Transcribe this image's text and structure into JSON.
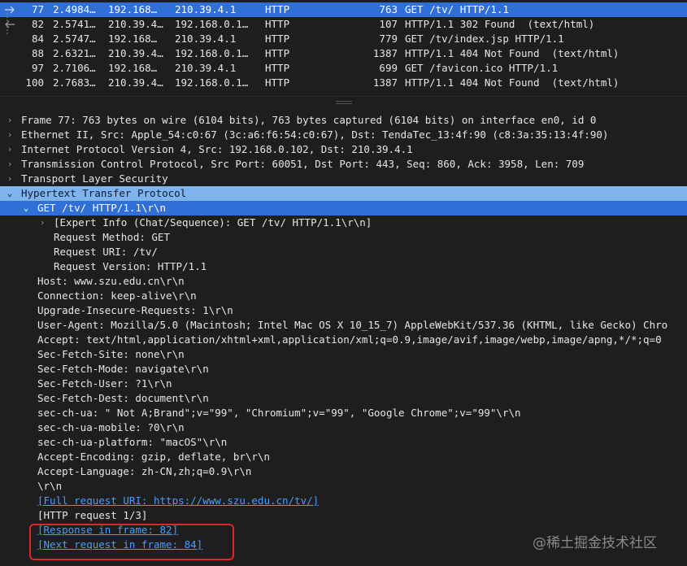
{
  "packets": [
    {
      "no": "77",
      "time": "2.4984…",
      "src": "192.168…",
      "dst": "210.39.4.1",
      "proto": "HTTP",
      "len": "763",
      "info": "GET /tv/ HTTP/1.1",
      "selected": true
    },
    {
      "no": "82",
      "time": "2.5741…",
      "src": "210.39.4…",
      "dst": "192.168.0.1…",
      "proto": "HTTP",
      "len": "107",
      "info": "HTTP/1.1 302 Found  (text/html)",
      "selected": false
    },
    {
      "no": "84",
      "time": "2.5747…",
      "src": "192.168…",
      "dst": "210.39.4.1",
      "proto": "HTTP",
      "len": "779",
      "info": "GET /tv/index.jsp HTTP/1.1",
      "selected": false
    },
    {
      "no": "88",
      "time": "2.6321…",
      "src": "210.39.4…",
      "dst": "192.168.0.1…",
      "proto": "HTTP",
      "len": "1387",
      "info": "HTTP/1.1 404 Not Found  (text/html)",
      "selected": false
    },
    {
      "no": "97",
      "time": "2.7106…",
      "src": "192.168…",
      "dst": "210.39.4.1",
      "proto": "HTTP",
      "len": "699",
      "info": "GET /favicon.ico HTTP/1.1",
      "selected": false
    },
    {
      "no": "100",
      "time": "2.7683…",
      "src": "210.39.4…",
      "dst": "192.168.0.1…",
      "proto": "HTTP",
      "len": "1387",
      "info": "HTTP/1.1 404 Not Found  (text/html)",
      "selected": false
    }
  ],
  "detail": {
    "frame": "Frame 77: 763 bytes on wire (6104 bits), 763 bytes captured (6104 bits) on interface en0, id 0",
    "ethernet": "Ethernet II, Src: Apple_54:c0:67 (3c:a6:f6:54:c0:67), Dst: TendaTec_13:4f:90 (c8:3a:35:13:4f:90)",
    "ip": "Internet Protocol Version 4, Src: 192.168.0.102, Dst: 210.39.4.1",
    "tcp": "Transmission Control Protocol, Src Port: 60051, Dst Port: 443, Seq: 860, Ack: 3958, Len: 709",
    "tls": "Transport Layer Security",
    "http": "Hypertext Transfer Protocol",
    "request_line": "GET /tv/ HTTP/1.1\\r\\n",
    "expert": "[Expert Info (Chat/Sequence): GET /tv/ HTTP/1.1\\r\\n]",
    "method": "Request Method: GET",
    "uri": "Request URI: /tv/",
    "version": "Request Version: HTTP/1.1",
    "headers": [
      "Host: www.szu.edu.cn\\r\\n",
      "Connection: keep-alive\\r\\n",
      "Upgrade-Insecure-Requests: 1\\r\\n",
      "User-Agent: Mozilla/5.0 (Macintosh; Intel Mac OS X 10_15_7) AppleWebKit/537.36 (KHTML, like Gecko) Chro",
      "Accept: text/html,application/xhtml+xml,application/xml;q=0.9,image/avif,image/webp,image/apng,*/*;q=0",
      "Sec-Fetch-Site: none\\r\\n",
      "Sec-Fetch-Mode: navigate\\r\\n",
      "Sec-Fetch-User: ?1\\r\\n",
      "Sec-Fetch-Dest: document\\r\\n",
      "sec-ch-ua: \" Not A;Brand\";v=\"99\", \"Chromium\";v=\"99\", \"Google Chrome\";v=\"99\"\\r\\n",
      "sec-ch-ua-mobile: ?0\\r\\n",
      "sec-ch-ua-platform: \"macOS\"\\r\\n",
      "Accept-Encoding: gzip, deflate, br\\r\\n",
      "Accept-Language: zh-CN,zh;q=0.9\\r\\n",
      "\\r\\n"
    ],
    "full_uri": "[Full request URI: https://www.szu.edu.cn/tv/]",
    "request_n": "[HTTP request 1/3]",
    "response_in": "[Response in frame: 82]",
    "next_request": "[Next request in frame: 84]"
  },
  "watermark": "@稀土掘金技术社区",
  "colors": {
    "selected": "#2f6fd6",
    "highlight": "#7fb3ee",
    "link": "#4b9cff",
    "annotation": "#e0262b"
  }
}
